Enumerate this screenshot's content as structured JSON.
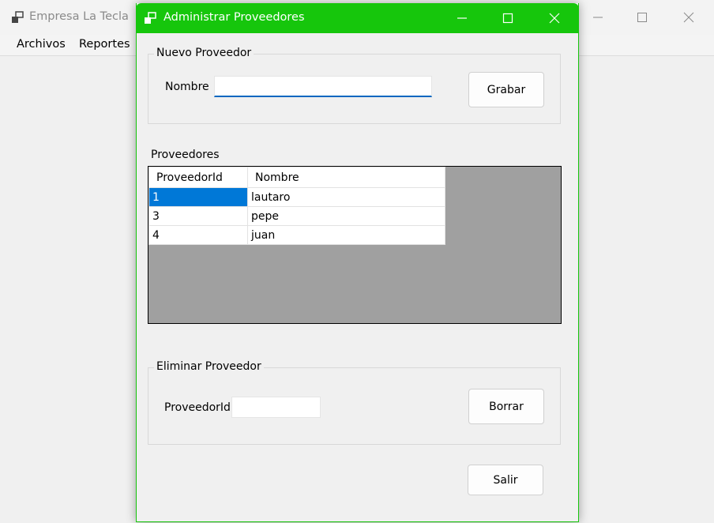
{
  "parent_window": {
    "title": "Empresa La Tecla",
    "menu": [
      "Archivos",
      "Reportes"
    ]
  },
  "dialog": {
    "title": "Administrar Proveedores",
    "accent_color": "#16c60c",
    "new_group": {
      "title": "Nuevo Proveedor",
      "name_label": "Nombre",
      "name_value": "",
      "save_button": "Grabar"
    },
    "list": {
      "title": "Proveedores",
      "columns": [
        "ProveedorId",
        "Nombre"
      ],
      "rows": [
        {
          "id": "1",
          "name": "lautaro",
          "selected": true
        },
        {
          "id": "3",
          "name": "pepe"
        },
        {
          "id": "4",
          "name": "juan"
        }
      ]
    },
    "delete_group": {
      "title": "Eliminar Proveedor",
      "id_label": "ProveedorId",
      "id_value": "",
      "delete_button": "Borrar"
    },
    "exit_button": "Salir"
  }
}
